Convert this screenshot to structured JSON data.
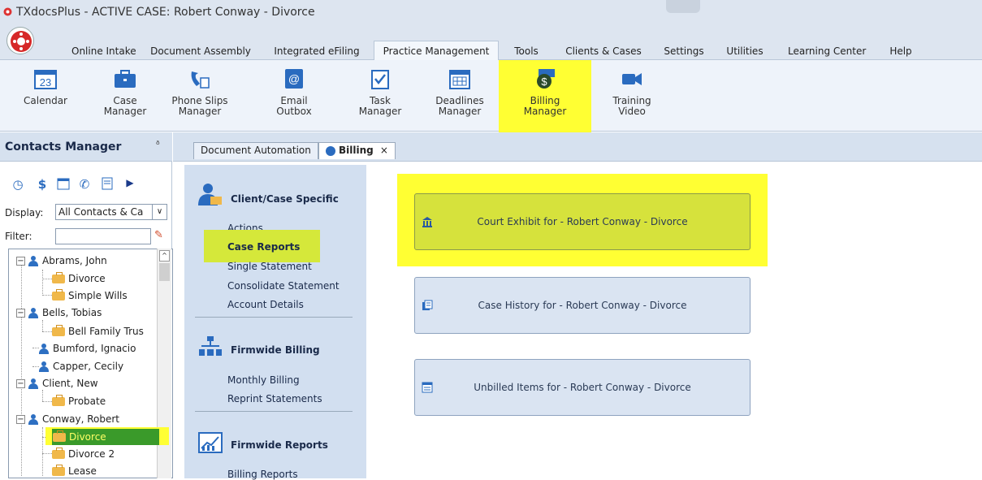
{
  "window": {
    "title": "TXdocsPlus - ACTIVE CASE: Robert Conway - Divorce"
  },
  "menu": {
    "tabs": [
      "Online Intake",
      "Document Assembly",
      "Integrated eFiling",
      "Practice Management",
      "Tools",
      "Clients & Cases",
      "Settings",
      "Utilities",
      "Learning Center",
      "Help"
    ],
    "active": "Practice Management"
  },
  "ribbon": {
    "buttons": [
      {
        "label1": "Calendar",
        "label2": "",
        "icon": "calendar-icon"
      },
      {
        "label1": "Case",
        "label2": "Manager",
        "icon": "briefcase-icon"
      },
      {
        "label1": "Phone Slips",
        "label2": "Manager",
        "icon": "phone-icon"
      },
      {
        "label1": "Email",
        "label2": "Outbox",
        "icon": "email-icon"
      },
      {
        "label1": "Task",
        "label2": "Manager",
        "icon": "task-icon"
      },
      {
        "label1": "Deadlines",
        "label2": "Manager",
        "icon": "deadline-calendar-icon"
      },
      {
        "label1": "Billing",
        "label2": "Manager",
        "icon": "billing-icon"
      },
      {
        "label1": "Training",
        "label2": "Video",
        "icon": "video-camera-icon"
      }
    ],
    "calendar_day": "23"
  },
  "contacts": {
    "header": "Contacts Manager",
    "display_label": "Display:",
    "display_value": "All Contacts & Ca",
    "filter_label": "Filter:",
    "filter_value": "",
    "tree": [
      {
        "type": "person",
        "label": "Abrams, John"
      },
      {
        "type": "case",
        "label": "Divorce"
      },
      {
        "type": "case",
        "label": "Simple Wills"
      },
      {
        "type": "person",
        "label": "Bells, Tobias"
      },
      {
        "type": "case",
        "label": "Bell Family Trus"
      },
      {
        "type": "person",
        "label": "Bumford, Ignacio"
      },
      {
        "type": "person",
        "label": "Capper, Cecily"
      },
      {
        "type": "person",
        "label": "Client, New"
      },
      {
        "type": "case",
        "label": "Probate"
      },
      {
        "type": "person",
        "label": "Conway, Robert"
      },
      {
        "type": "case",
        "label": "Divorce"
      },
      {
        "type": "case",
        "label": "Divorce 2"
      },
      {
        "type": "case",
        "label": "Lease"
      }
    ],
    "selected": "Divorce"
  },
  "doctabs": {
    "tab1": "Document Automation",
    "tab2": "Billing",
    "close": "×"
  },
  "nav": {
    "section1": {
      "title": "Client/Case Specific",
      "links": [
        "Actions",
        "Case Reports",
        "Single Statement",
        "Consolidate Statement",
        "Account Details"
      ]
    },
    "section2": {
      "title": "Firmwide Billing",
      "links": [
        "Monthly Billing",
        "Reprint Statements"
      ]
    },
    "section3": {
      "title": "Firmwide Reports",
      "links": [
        "Billing Reports"
      ]
    }
  },
  "reports": [
    "Court Exhibit for - Robert Conway - Divorce",
    "Case History for - Robert Conway - Divorce",
    "Unbilled Items for - Robert Conway - Divorce"
  ],
  "colors": {
    "highlight": "#ffff33",
    "selected_green": "#3a9a2a"
  }
}
